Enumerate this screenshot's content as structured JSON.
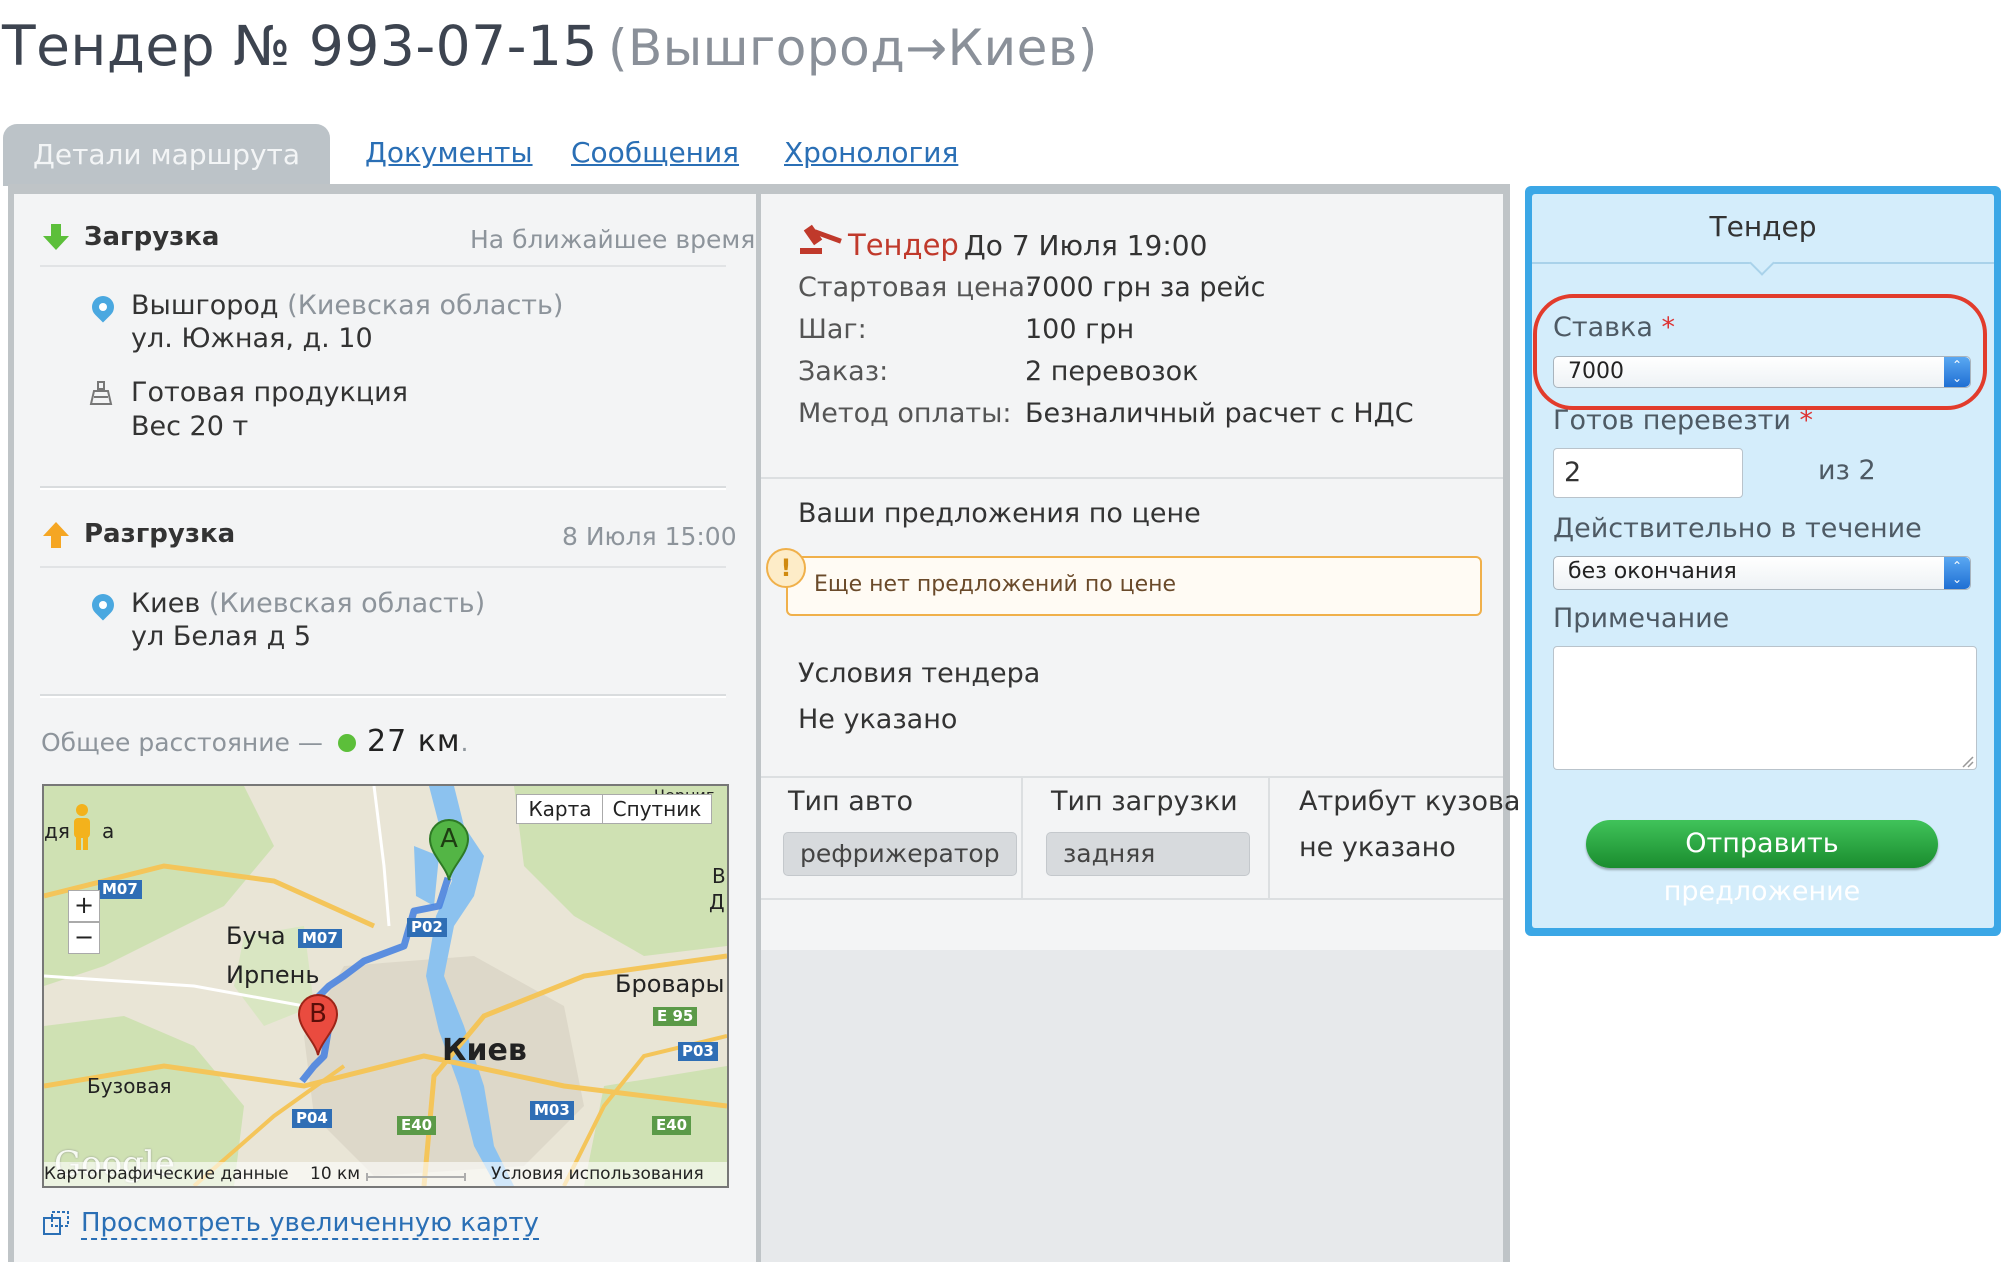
{
  "header": {
    "title": "Тендер № 993-07-15",
    "route": "(Вышгород→Киев)"
  },
  "tabs": [
    {
      "label": "Детали маршрута",
      "active": true
    },
    {
      "label": "Документы"
    },
    {
      "label": "Сообщения"
    },
    {
      "label": "Хронология"
    }
  ],
  "loading": {
    "label": "Загрузка",
    "time": "На ближайшее время",
    "city": "Вышгород",
    "region": "(Киевская область)",
    "address": "ул. Южная, д. 10",
    "cargo": "Готовая продукция",
    "weight": "Вес 20 т"
  },
  "unloading": {
    "label": "Разгрузка",
    "time": "8 Июля 15:00",
    "city": "Киев",
    "region": "(Киевская область)",
    "address": "ул Белая д 5"
  },
  "distance": {
    "label": "Общее расстояние —",
    "value": "27 км",
    "dot": "."
  },
  "map": {
    "btn_map": "Карта",
    "btn_sat": "Спутник",
    "cities": [
      "Буча",
      "Ирпень",
      "Бровары",
      "Киев",
      "Бузовая"
    ],
    "roads": [
      "M07",
      "M07",
      "P02",
      "E 95",
      "P03",
      "M03",
      "E40",
      "E40",
      "P04"
    ],
    "marker_a": "A",
    "marker_b": "B",
    "partial_left": "дя",
    "partial_left2": "а",
    "partial_topright": "Черниг",
    "partial_right1": "В",
    "partial_right2": "Д",
    "footer_data": "Картографические данные",
    "footer_scale": "10 км",
    "footer_terms": "Условия использования",
    "logo": "Google",
    "zoom_in": "+",
    "zoom_out": "−",
    "enlarge_link": "Просмотреть увеличенную карту"
  },
  "tender": {
    "label": "Тендер",
    "deadline": "До 7 Июля 19:00",
    "rows": [
      {
        "k": "Стартовая цена:",
        "v": "7000 грн за рейс"
      },
      {
        "k": "Шаг:",
        "v": "100 грн"
      },
      {
        "k": "Заказ:",
        "v": "2 перевозок"
      },
      {
        "k": "Метод оплаты:",
        "v": "Безналичный расчет с НДС"
      }
    ]
  },
  "offers": {
    "title": "Ваши предложения по цене",
    "empty": "Еще нет предложений по цене"
  },
  "conditions": {
    "title": "Условия тендера",
    "value": "Не указано"
  },
  "specs": [
    {
      "label": "Тип авто",
      "value": "рефрижератор"
    },
    {
      "label": "Тип загрузки",
      "value": "задняя"
    },
    {
      "label": "Атрибут кузова",
      "value": "не указано"
    }
  ],
  "bid_panel": {
    "title": "Тендер",
    "bid_label": "Ставка",
    "bid_value": "7000",
    "ready_label": "Готов перевезти",
    "ready_value": "2",
    "ready_of": "из 2",
    "valid_label": "Действительно в течение",
    "valid_value": "без окончания",
    "note_label": "Примечание",
    "required_mark": "*",
    "submit": "Отправить предложение"
  },
  "colors": {
    "accent_blue": "#3ba7e6",
    "submit_green": "#1f9a35",
    "highlight_red": "#e23c2c",
    "tender_red": "#c0392b"
  }
}
